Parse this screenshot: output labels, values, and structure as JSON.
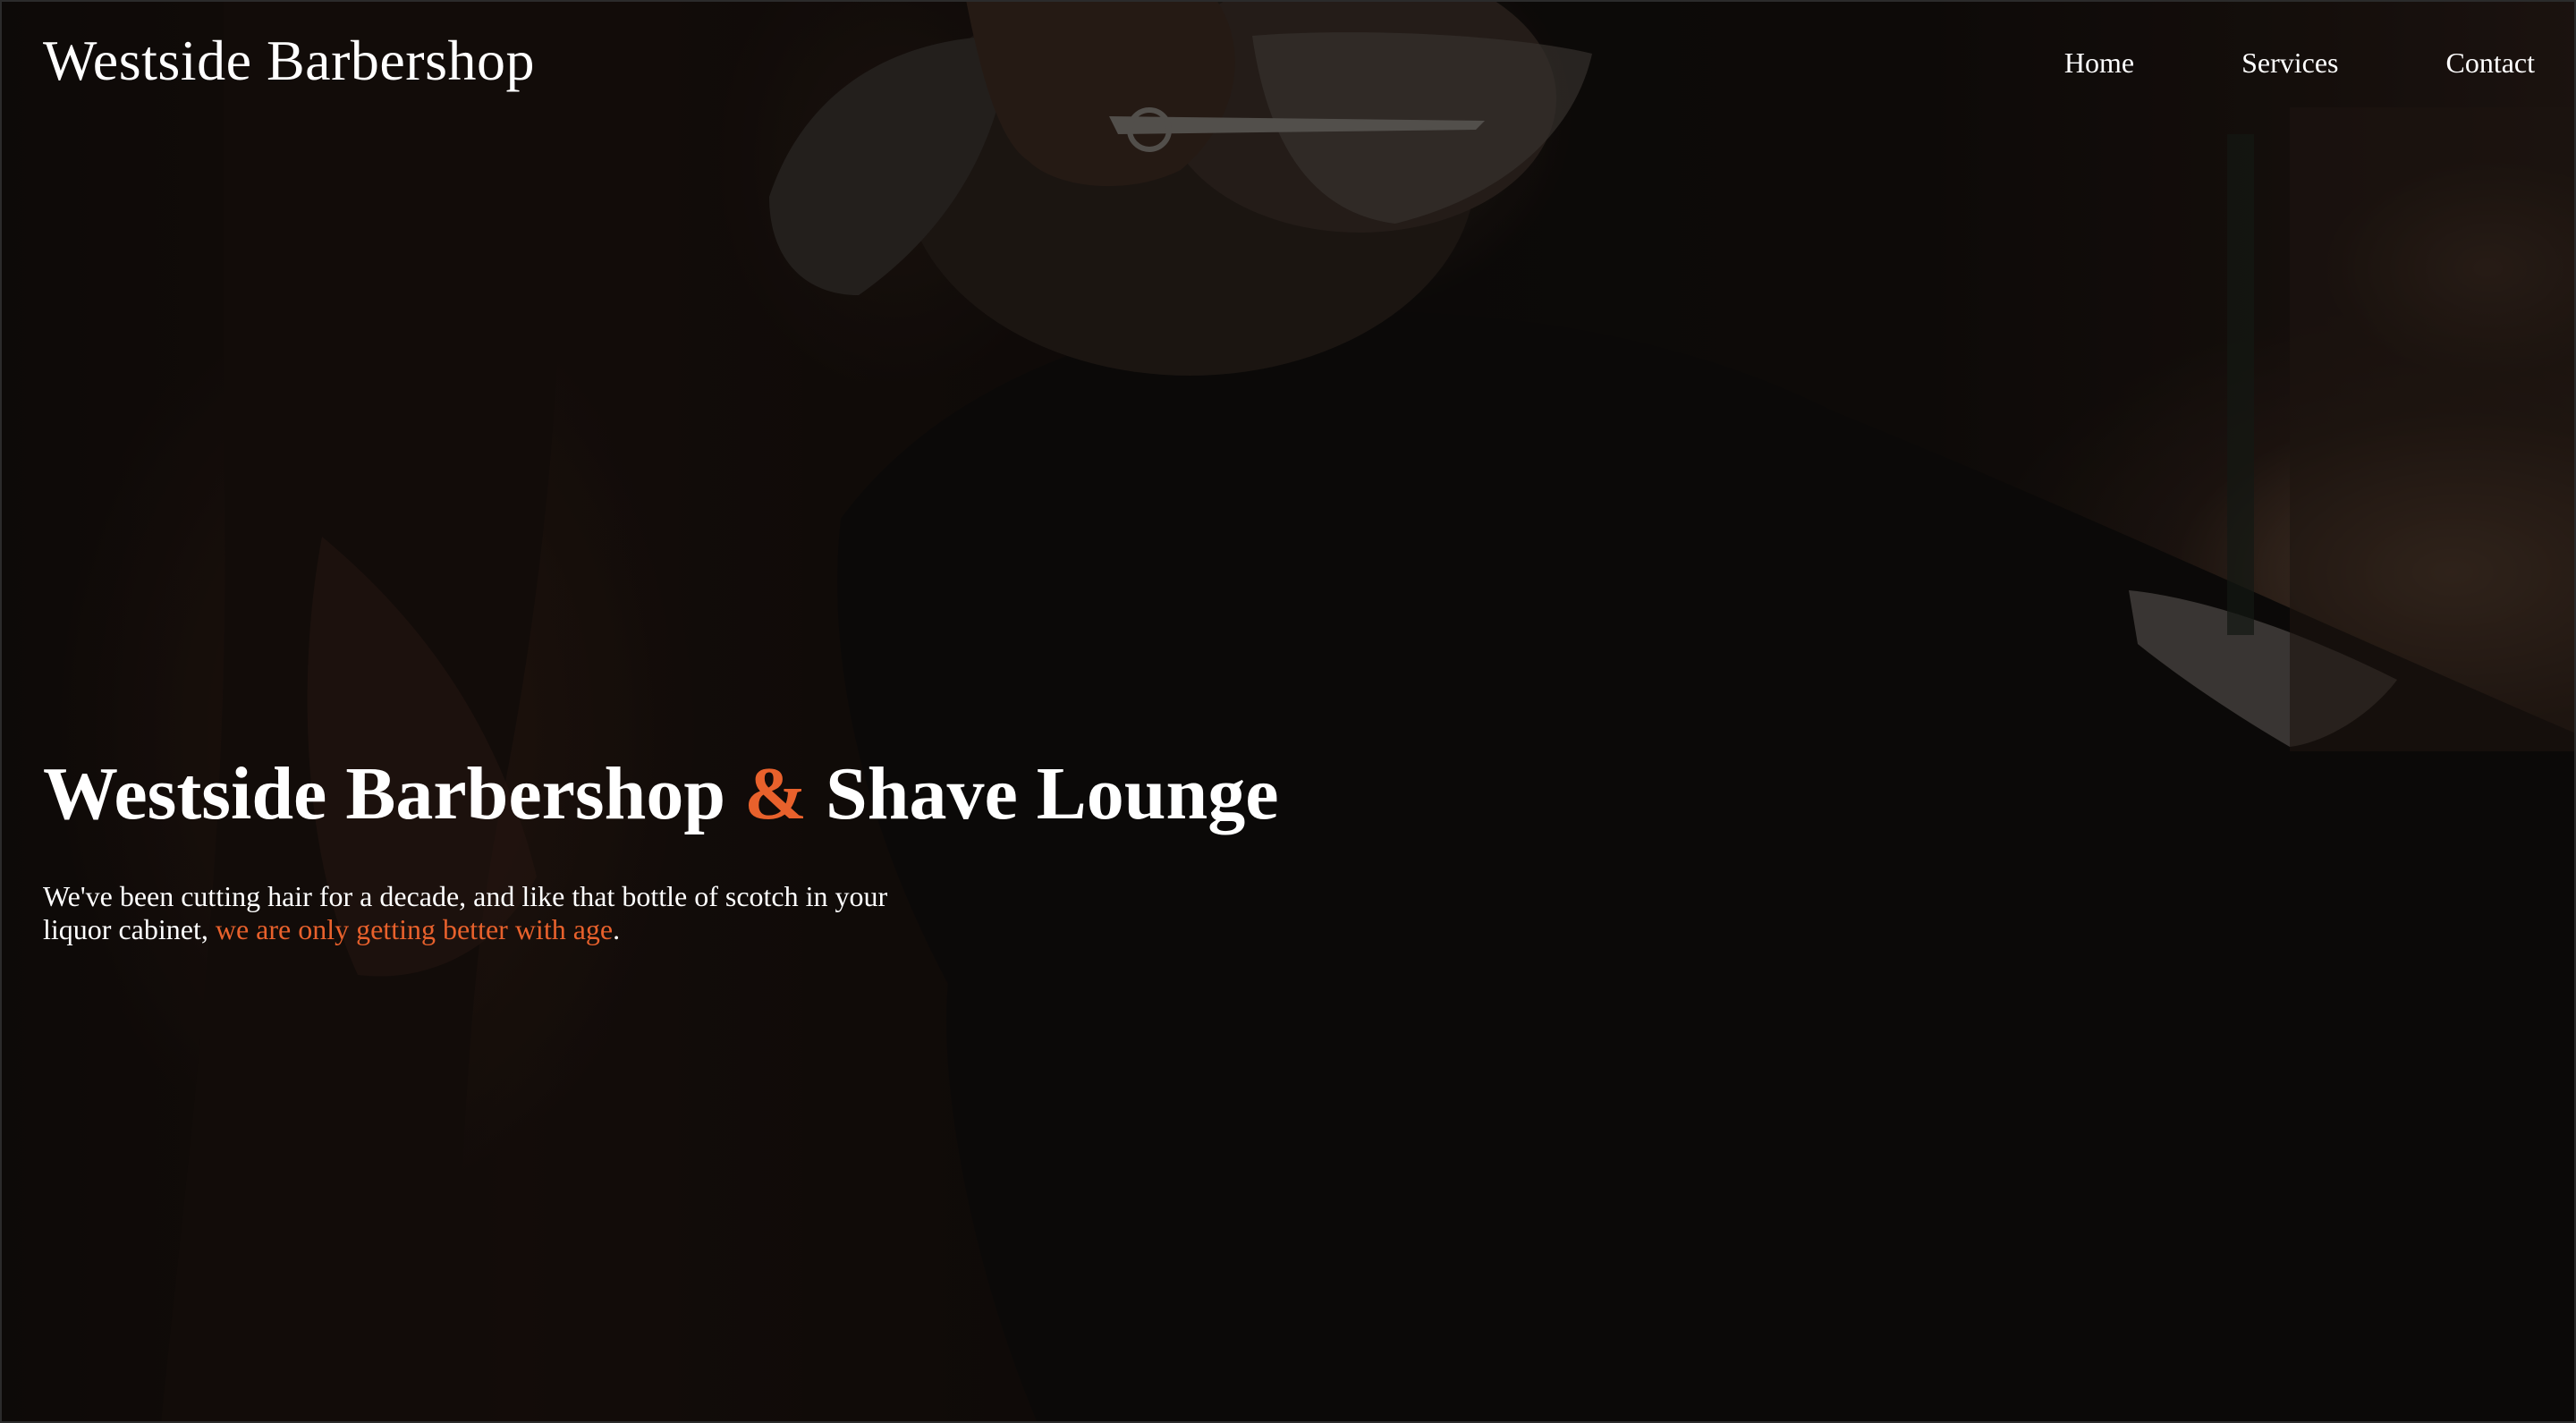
{
  "header": {
    "site_title": "Westside Barbershop",
    "nav": [
      {
        "label": "Home"
      },
      {
        "label": "Services"
      },
      {
        "label": "Contact"
      }
    ]
  },
  "hero": {
    "heading_part1": "Westside Barbershop",
    "heading_ampersand": "&",
    "heading_part2": "Shave Lounge",
    "text_part1": "We've been cutting hair for a decade, and like that bottle of scotch in your liquor cabinet,",
    "text_highlight": "we are only getting better with age",
    "text_end": ".",
    "background_image": "barber-trimming-beard-photo"
  },
  "colors": {
    "accent": "#e8612c",
    "text": "#ffffff",
    "background": "#0c0a09"
  }
}
